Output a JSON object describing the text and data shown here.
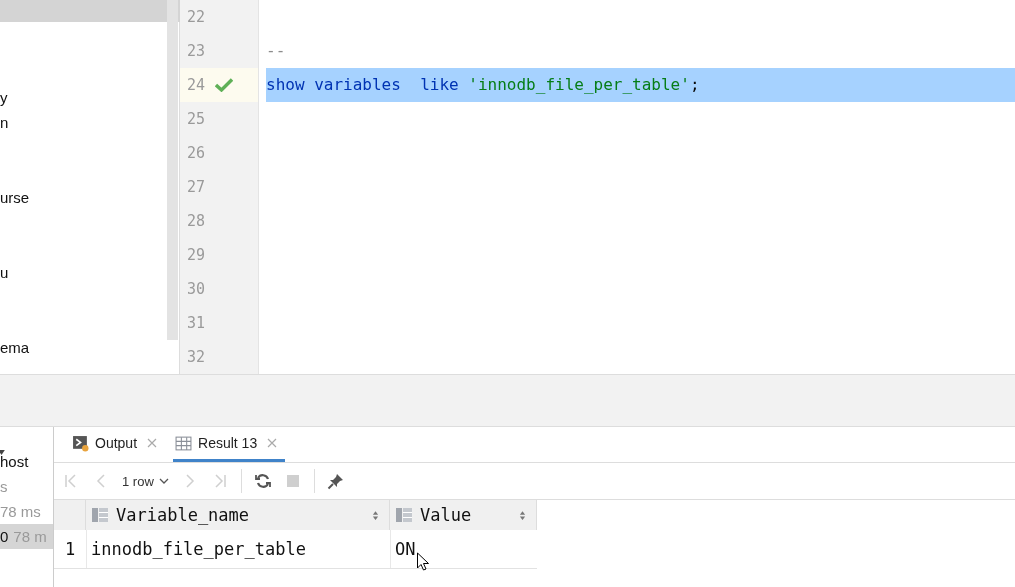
{
  "tree": {
    "items": [
      {
        "label": "y",
        "selected": false
      },
      {
        "label": "n",
        "selected": false
      },
      {
        "label": "urse",
        "selected": false
      },
      {
        "label": "u",
        "selected": false
      },
      {
        "label": "ema",
        "selected": false
      }
    ]
  },
  "editor": {
    "lines": [
      {
        "number": "22",
        "selected": false,
        "passed": false
      },
      {
        "number": "23",
        "selected": false,
        "passed": false,
        "tokens": [
          {
            "kind": "comment",
            "text": "--"
          }
        ]
      },
      {
        "number": "24",
        "selected": true,
        "passed": true,
        "tokens": [
          {
            "kind": "keyword",
            "text": "show "
          },
          {
            "kind": "keyword",
            "text": "variables  "
          },
          {
            "kind": "keyword",
            "text": "like "
          },
          {
            "kind": "string",
            "text": "'innodb_file_per_table'"
          },
          {
            "kind": "punct",
            "text": ";"
          }
        ]
      },
      {
        "number": "25",
        "selected": false,
        "passed": false
      },
      {
        "number": "26",
        "selected": false,
        "passed": false
      },
      {
        "number": "27",
        "selected": false,
        "passed": false
      },
      {
        "number": "28",
        "selected": false,
        "passed": false
      },
      {
        "number": "29",
        "selected": false,
        "passed": false
      },
      {
        "number": "30",
        "selected": false,
        "passed": false
      },
      {
        "number": "31",
        "selected": false,
        "passed": false
      },
      {
        "number": "32",
        "selected": false,
        "passed": false
      }
    ]
  },
  "services": {
    "items": [
      {
        "label": "host",
        "selected": false,
        "kind": "name"
      },
      {
        "label": "s",
        "selected": false,
        "kind": "dim"
      },
      {
        "label": "78 ms",
        "selected": false,
        "kind": "dim"
      },
      {
        "label": "0",
        "time": "78 m",
        "selected": true,
        "kind": "name"
      }
    ]
  },
  "tabs": [
    {
      "label": "Output",
      "kind": "output",
      "selected": false
    },
    {
      "label": "Result 13",
      "kind": "result",
      "selected": true
    }
  ],
  "toolbar": {
    "tools": [
      {
        "kind": "first",
        "disabled": true
      },
      {
        "kind": "prev",
        "disabled": true
      },
      {
        "kind": "rows",
        "label": "1 row"
      },
      {
        "kind": "next",
        "disabled": true
      },
      {
        "kind": "last",
        "disabled": true
      },
      {
        "kind": "sep"
      },
      {
        "kind": "refresh",
        "disabled": false
      },
      {
        "kind": "stop",
        "disabled": true
      },
      {
        "kind": "sep"
      },
      {
        "kind": "pin",
        "disabled": false
      }
    ]
  },
  "table": {
    "columns": [
      "Variable_name",
      "Value"
    ],
    "rows": [
      {
        "number": "1",
        "cells": [
          "innodb_file_per_table",
          "ON"
        ]
      }
    ]
  }
}
